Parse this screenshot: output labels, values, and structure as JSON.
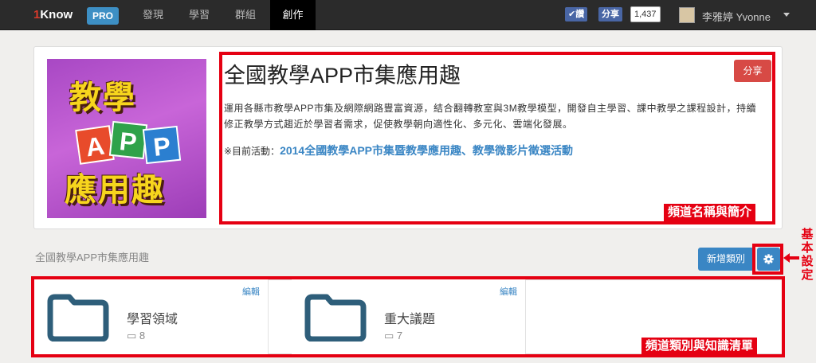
{
  "nav": {
    "logo_prefix": "1",
    "logo_text": "Know",
    "pro_badge": "PRO",
    "items": [
      {
        "label": "發現"
      },
      {
        "label": "學習"
      },
      {
        "label": "群組"
      },
      {
        "label": "創作"
      }
    ],
    "active_index": 3,
    "fb_like": "讚",
    "fb_share": "分享",
    "share_count": "1,437",
    "user_name": "李雅婷 Yvonne"
  },
  "channel": {
    "title": "全國教學APP市集應用趣",
    "share_label": "分享",
    "description": "運用各縣市教學APP市集及網際網路豐富資源，結合翻轉教室與3M教學模型，開發自主學習、課中教學之課程設計，持續修正教學方式趨近於學習者需求，促使教學朝向適性化、多元化、雲端化發展。",
    "activity_prefix": "※目前活動：",
    "activity_link": "2014全國教學APP市集暨教學應用趣、教學微影片徵選活動",
    "cover": {
      "word_top": "教學",
      "tiles": [
        "A",
        "P",
        "P"
      ],
      "word_bottom": "應用趣"
    }
  },
  "section": {
    "breadcrumb": "全國教學APP市集應用趣",
    "add_category_label": "新增類別"
  },
  "categories": [
    {
      "name": "學習領域",
      "count": "8",
      "edit_label": "編輯"
    },
    {
      "name": "重大議題",
      "count": "7",
      "edit_label": "編輯"
    }
  ],
  "annotations": {
    "channel_info": "頻道名稱與簡介",
    "basic_settings": "基本設定",
    "category_list": "頻道類別與知識清單"
  },
  "colors": {
    "accent_blue": "#3a86c4",
    "share_red": "#d74a45",
    "annotation_red": "#e50012",
    "folder_blue": "#2e5e7a"
  }
}
